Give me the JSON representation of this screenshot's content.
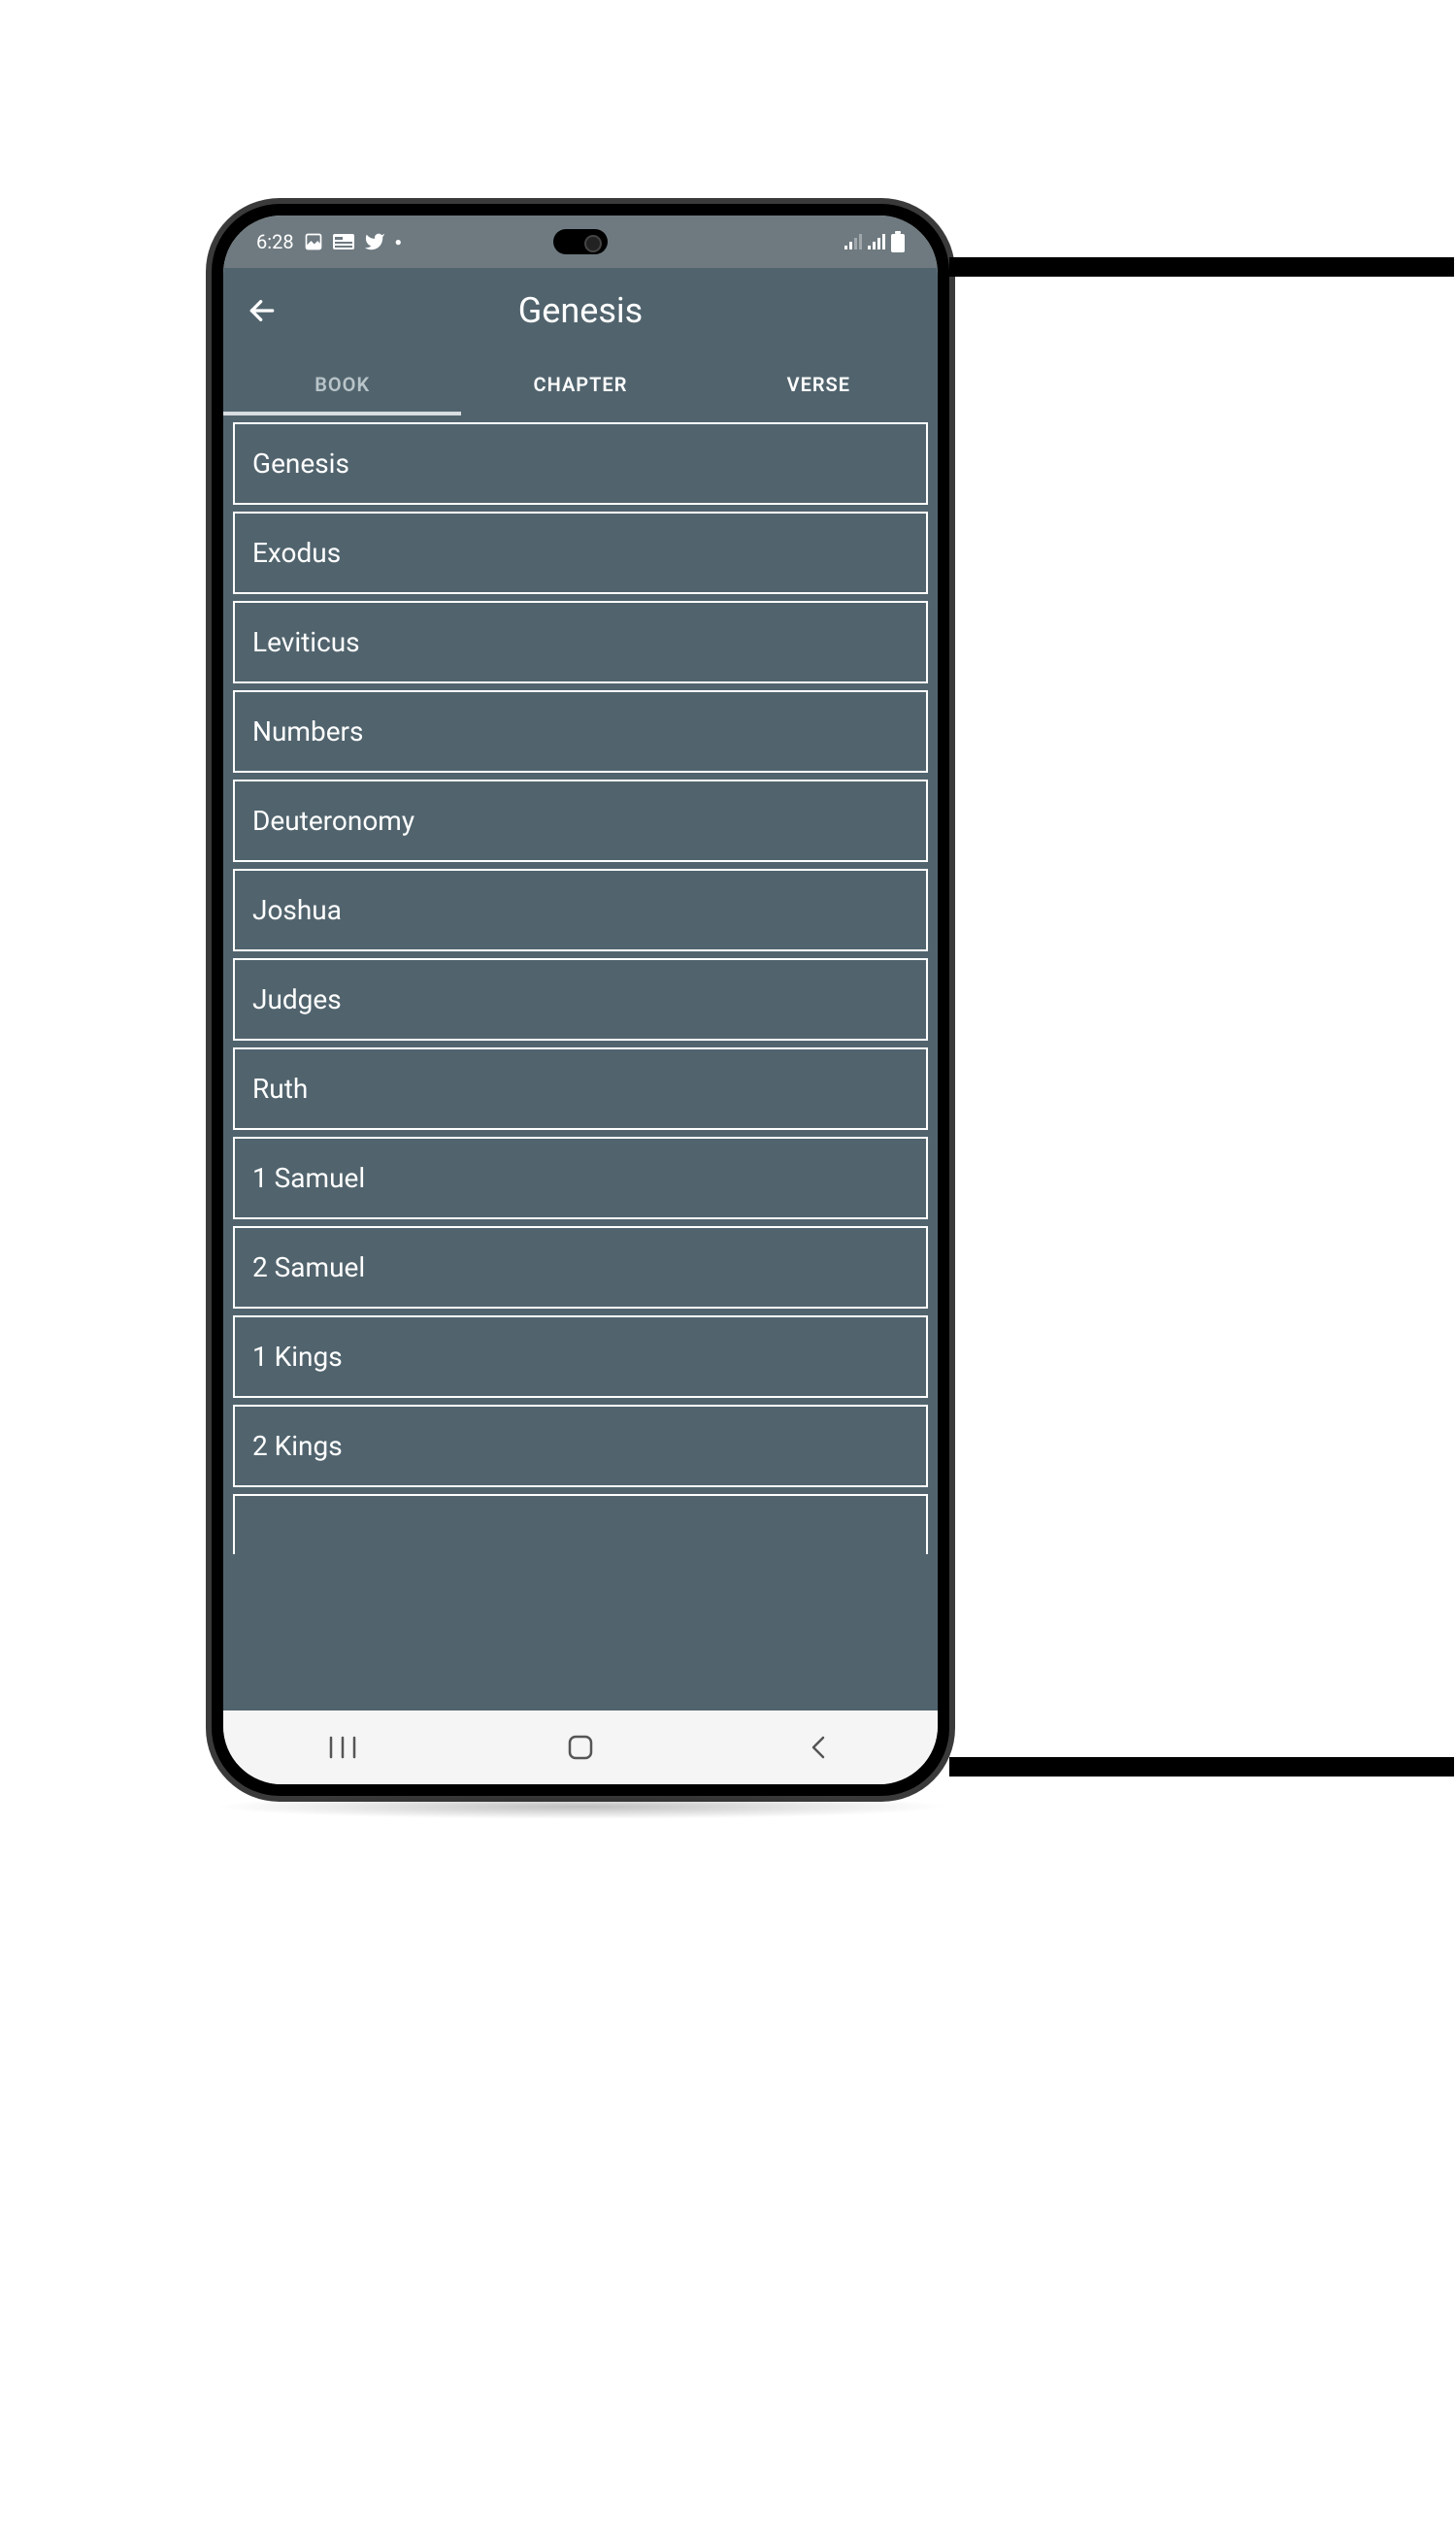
{
  "statusbar": {
    "time": "6:28",
    "icons_left": [
      "image-icon",
      "news-icon",
      "twitter-icon",
      "dot-icon"
    ],
    "icons_right": [
      "signal-weak-icon",
      "signal-icon",
      "battery-icon"
    ]
  },
  "header": {
    "title": "Genesis"
  },
  "tabs": [
    {
      "label": "BOOK",
      "active": true
    },
    {
      "label": "CHAPTER",
      "active": false
    },
    {
      "label": "VERSE",
      "active": false
    }
  ],
  "books": [
    "Genesis",
    "Exodus",
    "Leviticus",
    "Numbers",
    "Deuteronomy",
    "Joshua",
    "Judges",
    "Ruth",
    "1 Samuel",
    "2 Samuel",
    "1 Kings",
    "2 Kings"
  ],
  "navbar": {
    "recents": "recents",
    "home": "home",
    "back": "back"
  }
}
